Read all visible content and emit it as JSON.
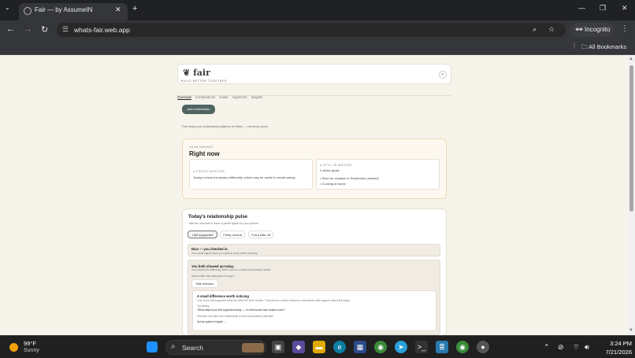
{
  "browser": {
    "tab_title": "Fair — by AssumeIN",
    "url": "whats-fair.web.app",
    "incognito_label": "Incognito",
    "all_bookmarks": "All Bookmarks"
  },
  "app": {
    "logo": "fair",
    "tagline": "BUILD BETTER TOGETHER",
    "nav": [
      "Overview",
      "Contributions",
      "Goals",
      "Alignment",
      "Insights"
    ],
    "add_button": "Add contribution",
    "intro": "Fair helps you understand patterns of effort — not keep score."
  },
  "right_now": {
    "kicker": "CALM INSIGHT",
    "title": "Right now",
    "left_kicker": "● FOCUS GENTLER",
    "left_text": "Today's check-ins landed differently, which may be useful to revisit calmly.",
    "right_kicker": "● STILL IN MOTION",
    "right_title": "2 active goals",
    "right_items": [
      "• Save for vacation in September (missed)",
      "• Cooking at home"
    ]
  },
  "pulse": {
    "title": "Today's relationship pulse",
    "subtitle": "Take ten seconds to leave a gentle signal for your partner.",
    "options": [
      "I felt supported",
      "Pretty neutral",
      "Felt a little off"
    ],
    "shared_title": "Nice — you checked in.",
    "shared_sub": "Your small signal helps your partner know what's working.",
    "both_title": "You both showed up today.",
    "both_sub": "You checked in differently, which can be a useful conversation starter.",
    "both_prompt": "Want a little help talking this through?",
    "hide_button": "Hide reflection",
    "diff_title": "A small difference worth noticing",
    "diff_text": "One of you felt supported while the other felt more neutral. That can be a useful chance to understand what support looked like today.",
    "try_asking": "Try asking:",
    "question": "\"What helped you feel supported today — or what would have helped more?\"",
    "premium": "Premium can offer your relationship a more personalized reflection.",
    "unlock": "Unlock guided insights →"
  },
  "taskbar": {
    "temp": "99°F",
    "weather": "Sunny",
    "search": "Search",
    "time": "3:24 PM",
    "date": "7/21/2026"
  }
}
